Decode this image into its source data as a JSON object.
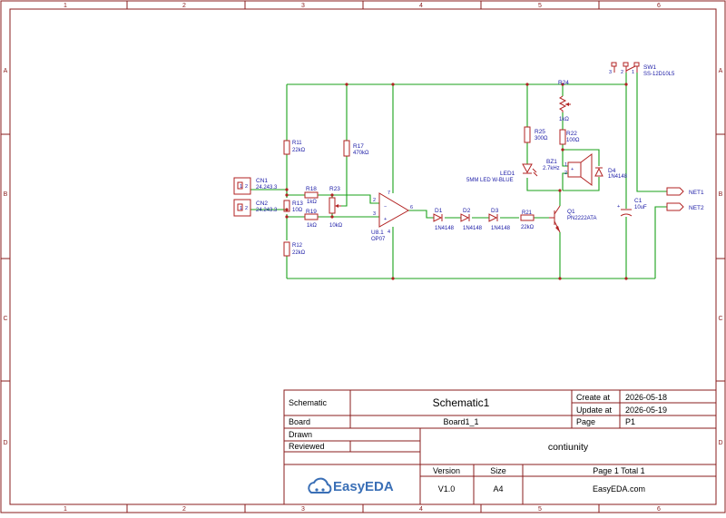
{
  "zones": {
    "cols": [
      "1",
      "2",
      "3",
      "4",
      "5",
      "6"
    ],
    "rows": [
      "A",
      "B",
      "C",
      "D"
    ]
  },
  "components": {
    "cn1": {
      "ref": "CN1",
      "value": "24.243.3"
    },
    "cn2": {
      "ref": "CN2",
      "value": "24.243.3"
    },
    "r11": {
      "ref": "R11",
      "value": "22kΩ"
    },
    "r12": {
      "ref": "R12",
      "value": "22kΩ"
    },
    "r13": {
      "ref": "R13",
      "value": "10Ω"
    },
    "r17": {
      "ref": "R17",
      "value": "470kΩ"
    },
    "r18": {
      "ref": "R18",
      "value": "1kΩ"
    },
    "r19": {
      "ref": "R19",
      "value": "1kΩ"
    },
    "r23": {
      "ref": "R23",
      "value": "10kΩ"
    },
    "r21": {
      "ref": "R21",
      "value": "22kΩ"
    },
    "r22": {
      "ref": "R22",
      "value": "100Ω"
    },
    "r24": {
      "ref": "R24",
      "value": "1kΩ"
    },
    "r25": {
      "ref": "R25",
      "value": "300Ω"
    },
    "u8": {
      "ref": "U8.1",
      "value": "OP07"
    },
    "d1": {
      "ref": "D1",
      "value": "1N4148"
    },
    "d2": {
      "ref": "D2",
      "value": "1N4148"
    },
    "d3": {
      "ref": "D3",
      "value": "1N4148"
    },
    "d4": {
      "ref": "D4",
      "value": "1N4148"
    },
    "led1": {
      "ref": "LED1",
      "value": "5MM LED W-BLUE"
    },
    "bz1": {
      "ref": "BZ1",
      "value": "2.7kHz"
    },
    "q1": {
      "ref": "Q1",
      "value": "PN2222ATA"
    },
    "c1": {
      "ref": "C1",
      "value": "10uF"
    },
    "sw1": {
      "ref": "SW1",
      "value": "SS-12D10L5"
    },
    "net1": "NET1",
    "net2": "NET2"
  },
  "pins": {
    "opamp_in_minus": "2",
    "opamp_in_plus": "3",
    "opamp_out": "6",
    "opamp_v_plus": "7",
    "opamp_v_minus": "4",
    "cn_1": "1",
    "cn_2": "2",
    "bz_1": "1",
    "bz_2": "2",
    "sw_1": "1",
    "sw_2": "2",
    "sw_3": "3"
  },
  "title_block": {
    "schematic_label": "Schematic",
    "schematic_name": "Schematic1",
    "create_label": "Create at",
    "create_date": "2026-05-18",
    "update_label": "Update at",
    "update_date": "2026-05-19",
    "board_label": "Board",
    "board_name": "Board1_1",
    "page_label": "Page",
    "page_value": "P1",
    "drawn_label": "Drawn",
    "reviewed_label": "Reviewed",
    "project_name": "contiunity",
    "version_label": "Version",
    "version_value": "V1.0",
    "size_label": "Size",
    "size_value": "A4",
    "page_total": "Page  1  Total  1",
    "website": "EasyEDA.com",
    "logo_text": "EasyEDA"
  },
  "colors": {
    "frame": "#8a1c1c",
    "wire": "#1aa11a",
    "component": "#b22222",
    "label": "#1a1aa6",
    "logo": "#3a6fb6"
  }
}
